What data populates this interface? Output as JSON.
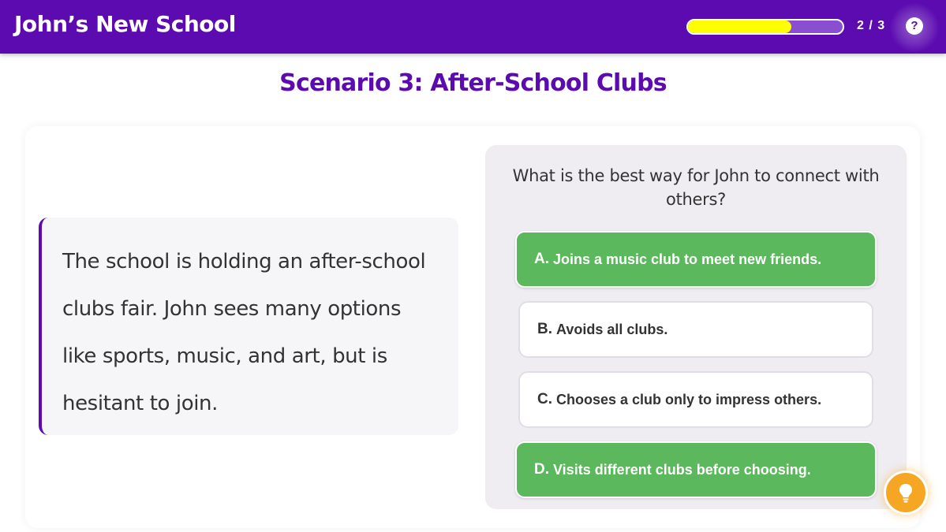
{
  "header": {
    "title": "John’s New School",
    "progress_text": "2 / 3",
    "progress_fraction": 0.67,
    "help_label": "?"
  },
  "scenario": {
    "title": "Scenario 3: After-School Clubs",
    "story": "The school is holding an after-school clubs fair. John sees many options like sports, music, and art, but is hesitant to join."
  },
  "question": {
    "text": "What is the best way for John to connect with others?",
    "options": [
      {
        "letter": "A.",
        "text": "Joins a music club to meet new friends.",
        "state": "correct"
      },
      {
        "letter": "B.",
        "text": "Avoids all clubs.",
        "state": "neutral"
      },
      {
        "letter": "C.",
        "text": "Chooses a club only to impress others.",
        "state": "neutral"
      },
      {
        "letter": "D.",
        "text": "Visits different clubs before choosing.",
        "state": "correct"
      }
    ]
  },
  "hint": {
    "icon": "lightbulb-icon"
  },
  "colors": {
    "primary": "#5c0bb0",
    "progress_fill": "#ffff00",
    "correct": "#5cb85c",
    "hint": "#f5a623"
  }
}
